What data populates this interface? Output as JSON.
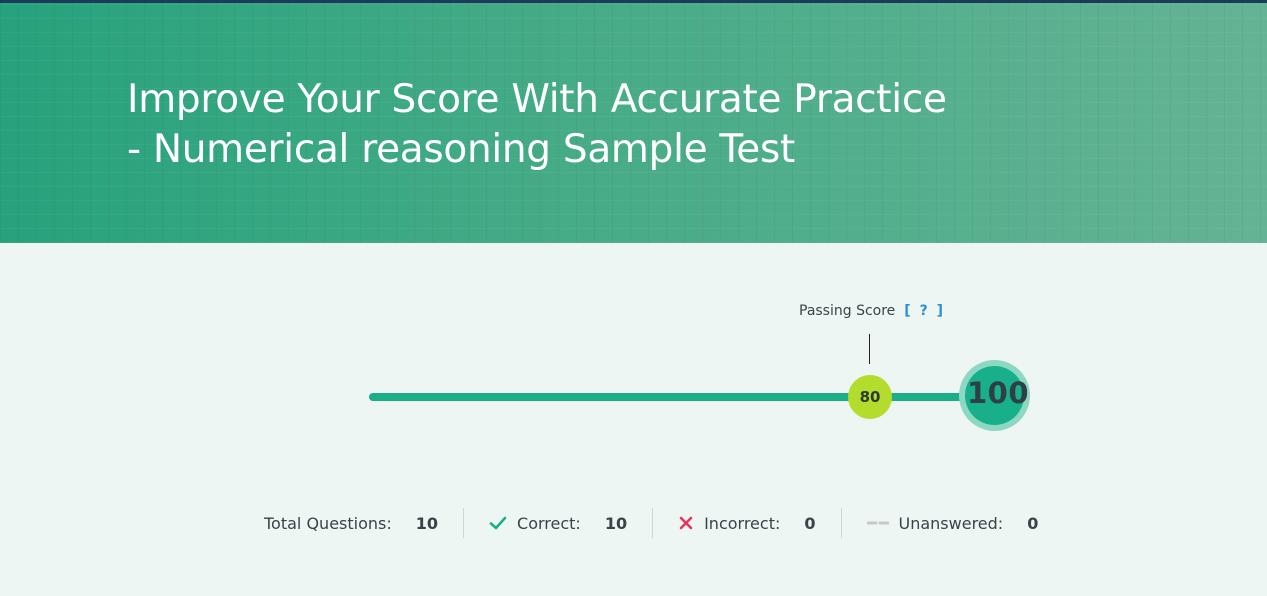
{
  "hero": {
    "title_line1": "Improve Your Score With Accurate Practice",
    "title_line2": "- Numerical reasoning Sample Test"
  },
  "score": {
    "passing_label": "Passing Score",
    "help_label": "[ ? ]",
    "passing_value": "80",
    "user_value": "100",
    "max_value": 100
  },
  "stats": {
    "total_label": "Total Questions:",
    "total_value": "10",
    "correct_label": "Correct:",
    "correct_value": "10",
    "incorrect_label": "Incorrect:",
    "incorrect_value": "0",
    "unanswered_label": "Unanswered:",
    "unanswered_value": "0"
  },
  "colors": {
    "accent": "#1cae88",
    "passing": "#b3dc2c",
    "correct": "#1cae88",
    "incorrect": "#e8345c",
    "unanswered": "#c4c9cb",
    "help_link": "#2d8fd5"
  },
  "icons": {
    "correct": "check-icon",
    "incorrect": "cross-icon",
    "unanswered": "dash-icon"
  }
}
